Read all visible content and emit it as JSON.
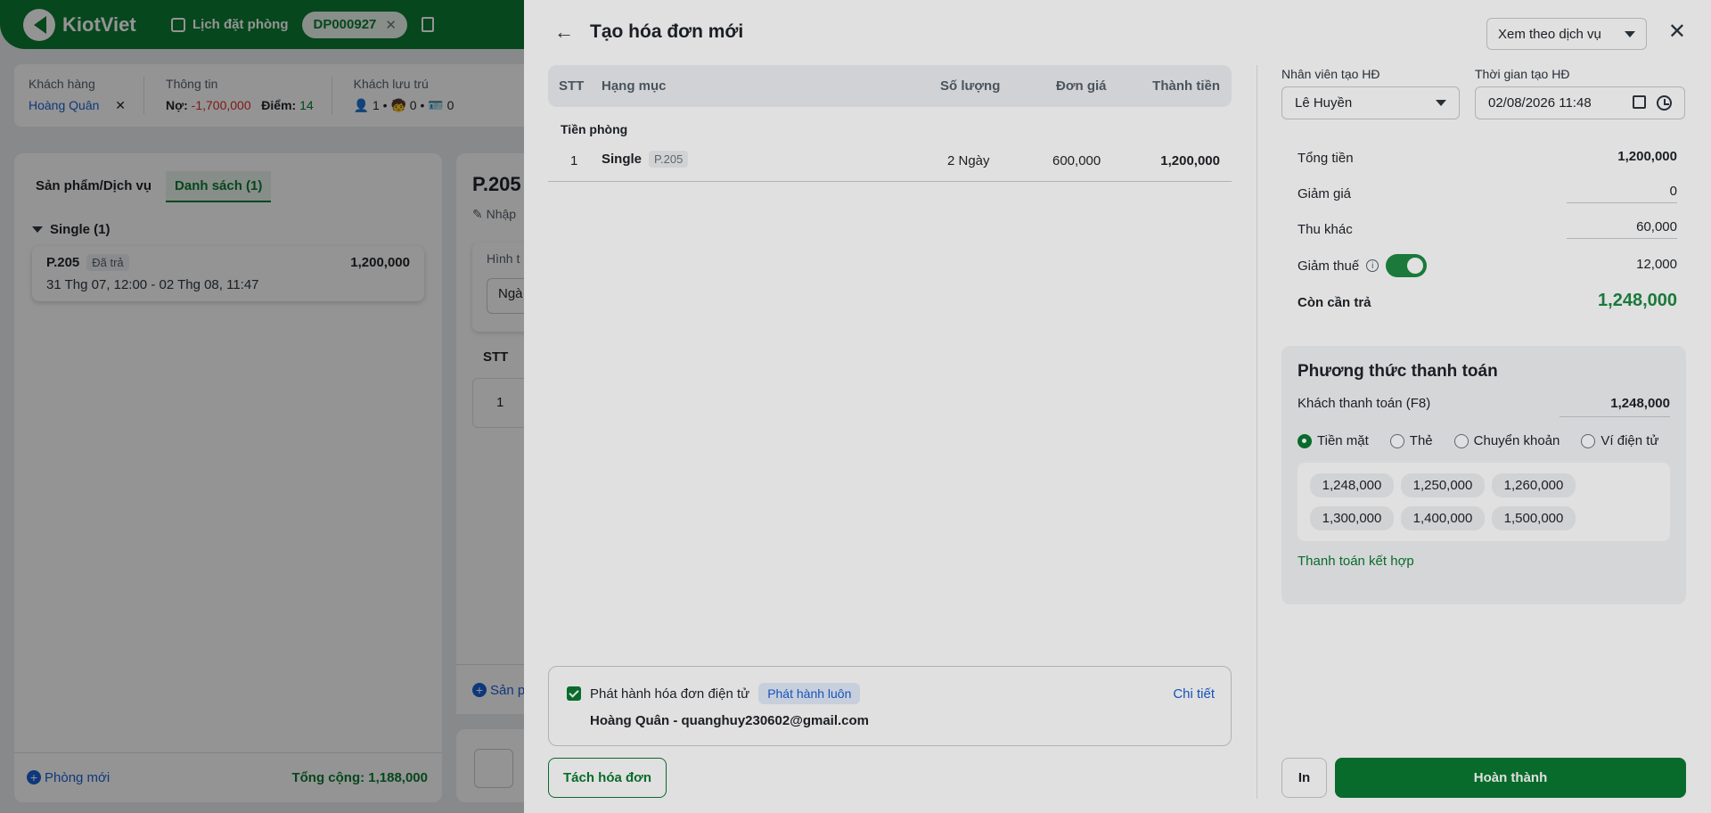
{
  "app": {
    "brand": "KiotViet",
    "booking_label": "Lịch đặt phòng",
    "booking_code": "DP000927"
  },
  "info_bar": {
    "customer_label": "Khách hàng",
    "customer_name": "Hoàng Quân",
    "info_label": "Thông tin",
    "debt_label": "Nợ:",
    "debt_value": "-1,700,000",
    "points_label": "Điểm:",
    "points_value": "14",
    "guests_label": "Khách lưu trú",
    "adults": "1",
    "children": "0",
    "ids": "0"
  },
  "left_panel": {
    "tab_products": "Sản phẩm/Dịch vụ",
    "tab_list": "Danh sách (1)",
    "group_title": "Single (1)",
    "room_code": "P.205",
    "room_status": "Đã trả",
    "room_amount": "1,200,000",
    "room_dates": "31 Thg 07, 12:00 - 02 Thg 08, 11:47",
    "new_room": "Phòng mới",
    "total": "Tổng cộng: 1,188,000"
  },
  "mid_panel": {
    "title": "P.205",
    "note": "Nhập",
    "form_label": "Hình t",
    "form_value": "Ngà",
    "stt": "STT",
    "row_no": "1",
    "add_product": "Sản p"
  },
  "modal": {
    "title": "Tạo hóa đơn mới",
    "view_mode": "Xem theo dịch vụ",
    "table": {
      "headers": {
        "stt": "STT",
        "item": "Hạng mục",
        "qty": "Số lượng",
        "price": "Đơn giá",
        "total": "Thành tiền"
      },
      "section": "Tiền phòng",
      "rows": [
        {
          "stt": "1",
          "item": "Single",
          "room": "P.205",
          "qty": "2 Ngày",
          "price": "600,000",
          "total": "1,200,000"
        }
      ]
    },
    "einvoice": {
      "label": "Phát hành hóa đơn điện tử",
      "badge": "Phát hành luôn",
      "detail": "Chi tiết",
      "customer": "Hoàng Quân - quanghuy230602@gmail.com"
    },
    "split_button": "Tách hóa đơn",
    "staff_label": "Nhân viên tạo HĐ",
    "staff_value": "Lê Huyền",
    "time_label": "Thời gian tạo HĐ",
    "time_value": "02/08/2026 11:48",
    "summary": {
      "total_label": "Tổng tiền",
      "total_value": "1,200,000",
      "discount_label": "Giảm giá",
      "discount_value": "0",
      "other_label": "Thu khác",
      "other_value": "60,000",
      "tax_label": "Giảm thuế",
      "tax_value": "12,000",
      "due_label": "Còn cần trả",
      "due_value": "1,248,000"
    },
    "payment": {
      "title": "Phương thức thanh toán",
      "customer_pay_label": "Khách thanh toán (F8)",
      "customer_pay_value": "1,248,000",
      "methods": [
        "Tiền mặt",
        "Thẻ",
        "Chuyển khoản",
        "Ví điện tử"
      ],
      "quick_amounts": [
        "1,248,000",
        "1,250,000",
        "1,260,000",
        "1,300,000",
        "1,400,000",
        "1,500,000"
      ],
      "combo": "Thanh toán kết hợp"
    },
    "print_button": "In",
    "done_button": "Hoàn thành"
  }
}
